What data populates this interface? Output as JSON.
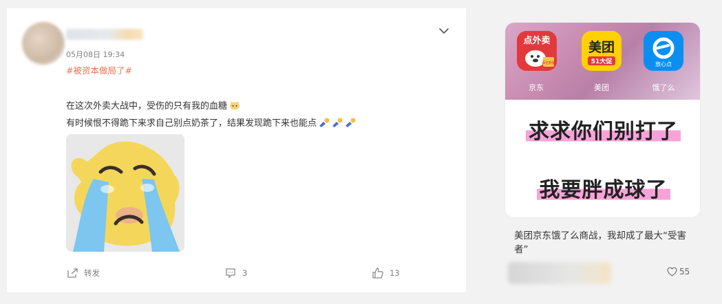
{
  "post": {
    "time": "05月08日 19:34",
    "topic": "#被资本做局了#",
    "line1": "在这次外卖大战中，受伤的只有我的血糖",
    "line2": "有时候恨不得跪下来求自己别点奶茶了，结果发现跪下来也能点",
    "actions": {
      "repost": "转发",
      "comment_count": "3",
      "like_count": "13"
    }
  },
  "side_card": {
    "apps": [
      {
        "name": "京东",
        "icon_text": "点外卖",
        "badge": "百亿补贴"
      },
      {
        "name": "美团",
        "icon_text": "美团",
        "badge": "51大促"
      },
      {
        "name": "饿了么",
        "icon_text": "e",
        "badge": "放心点"
      }
    ],
    "slogan1": "求求你们别打了",
    "slogan2": "我要胖成球了",
    "title": "美团京东饿了么商战，我却成了最大“受害者”",
    "likes": "55"
  },
  "colors": {
    "topic": "#eb7350",
    "highlight": "#f7a3d8",
    "jd_red": "#e4393c",
    "meituan_yellow": "#ffd100",
    "eleme_blue": "#0a8ff0"
  }
}
